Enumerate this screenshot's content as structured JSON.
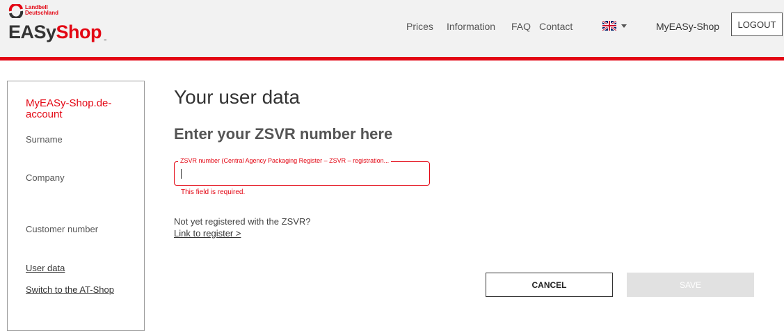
{
  "header": {
    "logo": {
      "brand_line1": "Landbell",
      "brand_line2": "Deutschland",
      "title_part1": "EASy",
      "title_part2": "Shop",
      "caret": "-",
      "mark_icon": "landbell-logo-icon"
    },
    "nav": [
      {
        "label": "Prices"
      },
      {
        "label": "Information"
      },
      {
        "label": "FAQ"
      },
      {
        "label": "Contact"
      }
    ],
    "language_icon": "uk-flag-icon",
    "account_link": "MyEASy-Shop",
    "logout_label": "LOGOUT"
  },
  "sidebar": {
    "title": "MyEASy-Shop.de-account",
    "labels": [
      {
        "label": "Surname"
      },
      {
        "label": "Company"
      },
      {
        "label": "Customer number"
      }
    ],
    "links": [
      {
        "label": "User data"
      },
      {
        "label": "Switch to the AT-Shop"
      }
    ]
  },
  "main": {
    "title": "Your user data",
    "subtitle": "Enter your ZSVR number here",
    "zsvr_field": {
      "label": "ZSVR number (Central Agency Packaging Register – ZSVR – registration...",
      "value": "",
      "error": "This field is required."
    },
    "not_registered_text": "Not yet registered with the ZSVR?",
    "register_link": "Link to register >",
    "cancel_label": "CANCEL",
    "save_label": "SAVE"
  },
  "colors": {
    "brand_red": "#e30613",
    "header_bg": "#f2f2f2",
    "disabled_button": "#e1e1e1"
  }
}
